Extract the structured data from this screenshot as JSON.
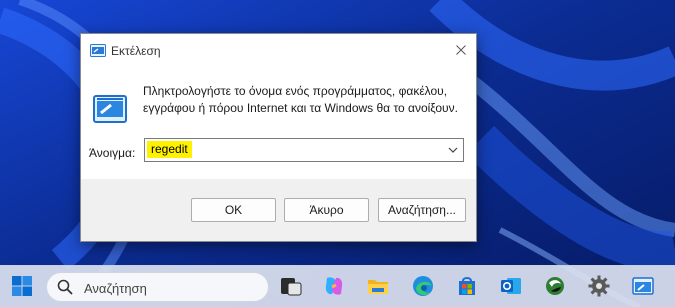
{
  "dialog": {
    "title": "Εκτέλεση",
    "description": "Πληκτρολογήστε το όνομα ενός προγράμματος, φακέλου, εγγράφου ή πόρου Internet και τα Windows θα το ανοίξουν.",
    "open_label": "Άνοιγμα:",
    "open_value": "regedit",
    "buttons": {
      "ok": "OK",
      "cancel": "Άκυρο",
      "browse": "Αναζήτηση..."
    }
  },
  "taskbar": {
    "search_placeholder": "Αναζήτηση",
    "icons": [
      "start-icon",
      "search-icon",
      "task-view-icon",
      "copilot-icon",
      "file-explorer-icon",
      "edge-icon",
      "store-icon",
      "outlook-icon",
      "gimp-icon",
      "settings-icon",
      "run-icon"
    ]
  },
  "colors": {
    "desktop": "#0a2a8c",
    "highlight": "#fff200",
    "accent": "#0067c0"
  }
}
